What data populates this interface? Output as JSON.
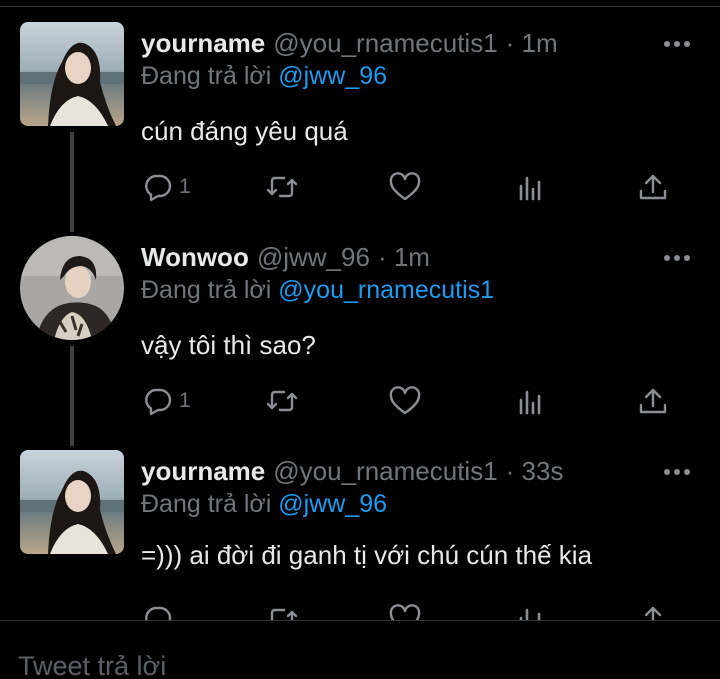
{
  "tweets": [
    {
      "name": "yourname",
      "handle": "@you_rnamecutis1",
      "time": "· 1m",
      "reply_label": "Đang trả lời",
      "reply_to": "@jww_96",
      "text": "cún đáng yêu quá",
      "reply_count": "1"
    },
    {
      "name": "Wonwoo",
      "handle": "@jww_96",
      "time": "· 1m",
      "reply_label": "Đang trả lời",
      "reply_to": "@you_rnamecutis1",
      "text": "vậy tôi thì sao?",
      "reply_count": "1"
    },
    {
      "name": "yourname",
      "handle": "@you_rnamecutis1",
      "time": "· 33s",
      "reply_label": "Đang trả lời",
      "reply_to": "@jww_96",
      "text": "=))) ai đời đi ganh tị với chú cún thế kia",
      "reply_count": ""
    }
  ],
  "composer": {
    "placeholder": "Tweet trả lời"
  },
  "colors": {
    "background": "#000000",
    "text": "#e7e9ea",
    "muted": "#71767b",
    "link": "#1d9bf0",
    "divider": "#2f3336"
  },
  "icons": [
    "reply-icon",
    "retweet-icon",
    "like-icon",
    "views-icon",
    "share-icon",
    "more-options-icon"
  ]
}
